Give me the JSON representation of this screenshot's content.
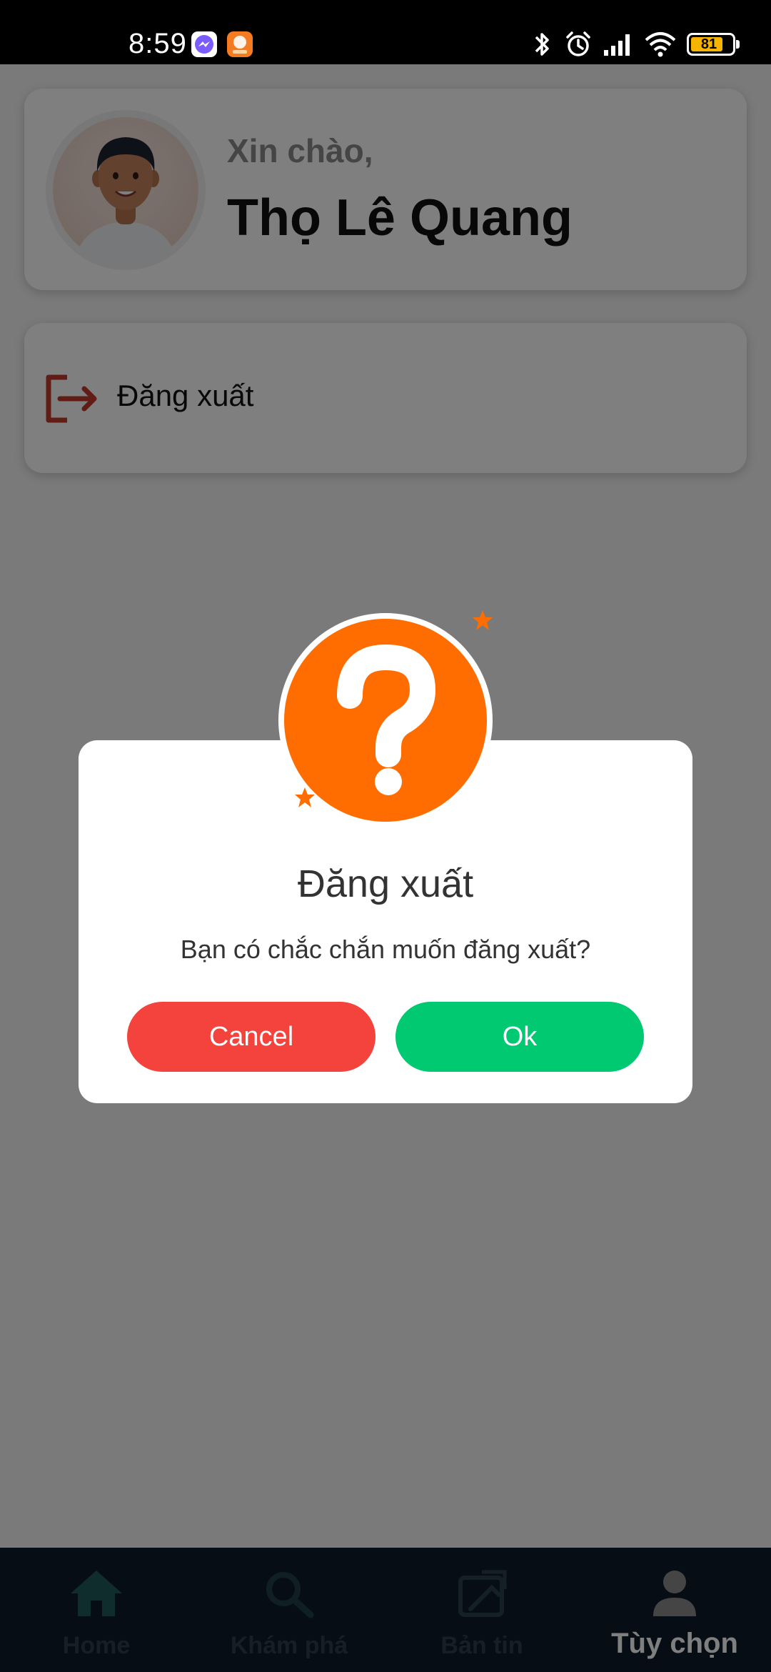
{
  "status_bar": {
    "time": "8:59",
    "battery_level": "81",
    "icons": [
      "messenger-icon",
      "shopee-icon",
      "bluetooth-icon",
      "alarm-icon",
      "signal-icon",
      "wifi-icon",
      "battery-icon"
    ]
  },
  "profile": {
    "greeting": "Xin chào,",
    "name": "Thọ Lê Quang"
  },
  "menu": {
    "logout_label": "Đăng xuất"
  },
  "dialog": {
    "title": "Đăng xuất",
    "message": "Bạn có chắc chắn muốn đăng xuất?",
    "cancel_label": "Cancel",
    "ok_label": "Ok",
    "badge_symbol": "?"
  },
  "bottom_nav": {
    "items": [
      {
        "label": "Home",
        "icon": "home-icon"
      },
      {
        "label": "Khám phá",
        "icon": "search-icon"
      },
      {
        "label": "Bản tin",
        "icon": "news-icon"
      },
      {
        "label": "Tùy chọn",
        "icon": "person-icon"
      }
    ],
    "active_index": 3
  },
  "colors": {
    "accent_orange": "#ff6d00",
    "cancel_red": "#f4433c",
    "ok_green": "#00c972",
    "logout_icon_red": "#c0392b"
  }
}
